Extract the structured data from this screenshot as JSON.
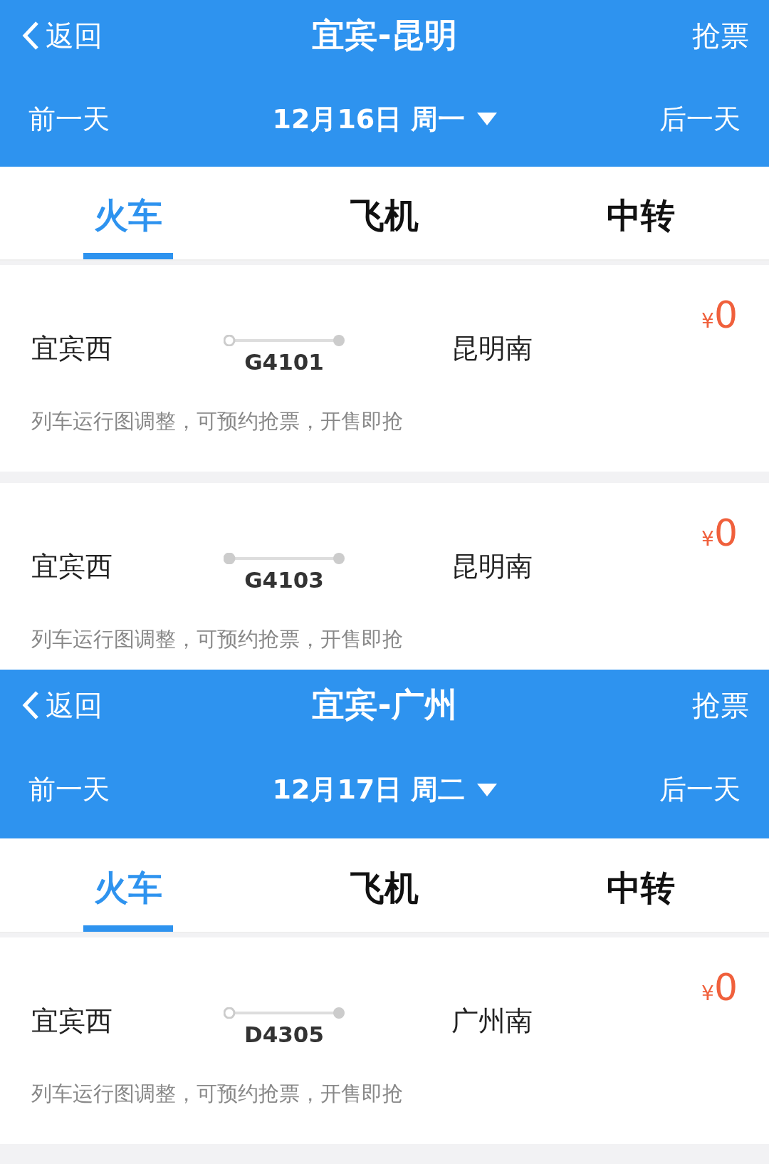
{
  "panels": [
    {
      "header": {
        "back_label": "返回",
        "title": "宜宾-昆明",
        "action": "抢票"
      },
      "date_bar": {
        "prev": "前一天",
        "date": "12月16日 周一",
        "next": "后一天"
      },
      "tabs": [
        {
          "label": "火车",
          "selected": true
        },
        {
          "label": "飞机",
          "selected": false
        },
        {
          "label": "中转",
          "selected": false
        }
      ],
      "trains": [
        {
          "from": "宜宾西",
          "number": "G4101",
          "to": "昆明南",
          "currency": "¥",
          "price": "0",
          "note": "列车运行图调整，可预约抢票，开售即抢",
          "start_dot_filled": false
        },
        {
          "from": "宜宾西",
          "number": "G4103",
          "to": "昆明南",
          "currency": "¥",
          "price": "0",
          "note": "列车运行图调整，可预约抢票，开售即抢",
          "start_dot_filled": true
        }
      ]
    },
    {
      "header": {
        "back_label": "返回",
        "title": "宜宾-广州",
        "action": "抢票"
      },
      "date_bar": {
        "prev": "前一天",
        "date": "12月17日 周二",
        "next": "后一天"
      },
      "tabs": [
        {
          "label": "火车",
          "selected": true
        },
        {
          "label": "飞机",
          "selected": false
        },
        {
          "label": "中转",
          "selected": false
        }
      ],
      "trains": [
        {
          "from": "宜宾西",
          "number": "D4305",
          "to": "广州南",
          "currency": "¥",
          "price": "0",
          "note": "列车运行图调整，可预约抢票，开售即抢",
          "start_dot_filled": false
        }
      ]
    }
  ]
}
